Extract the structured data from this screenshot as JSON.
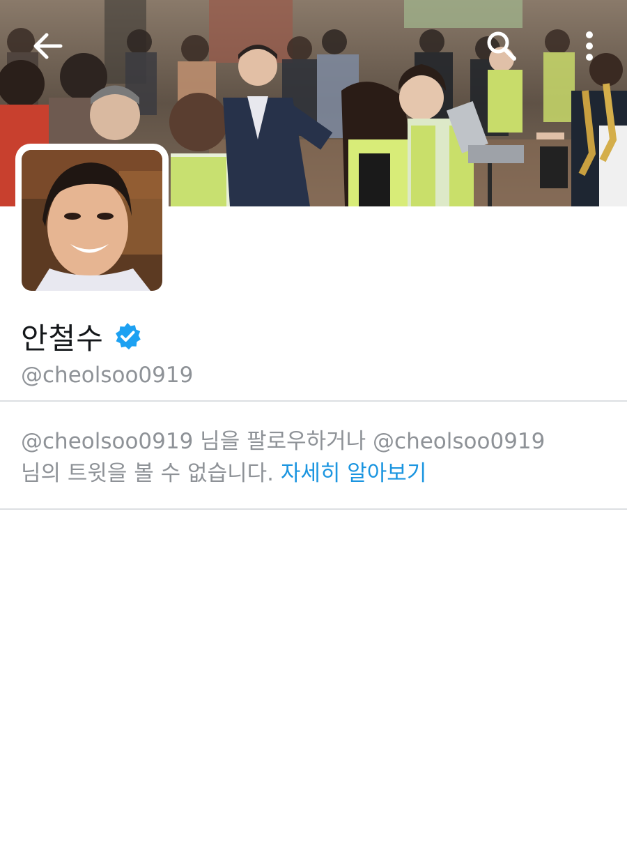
{
  "profile": {
    "display_name": "안철수",
    "handle": "@cheolsoo0919",
    "verified": true
  },
  "notice": {
    "line1": "@cheolsoo0919 님을 팔로우하거나 @cheolsoo0919",
    "line2_text": "님의 트윗을 볼 수 없습니다. ",
    "learn_more": "자세히 알아보기"
  },
  "icons": {
    "back": "back-arrow-icon",
    "search": "search-icon",
    "more": "more-vertical-icon",
    "verified": "verified-badge-icon"
  },
  "colors": {
    "link": "#1b95e0",
    "verified": "#1da1f2",
    "secondary_text": "#8e9297",
    "primary_text": "#14171a",
    "divider": "#dcdfe2"
  }
}
